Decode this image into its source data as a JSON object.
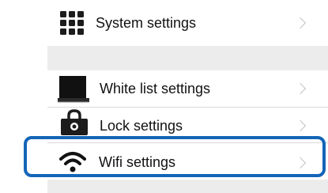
{
  "settings": {
    "items": [
      {
        "label": "System settings",
        "icon": "grid-icon"
      },
      {
        "label": "White list settings",
        "icon": "folder-icon"
      },
      {
        "label": "Lock settings",
        "icon": "lock-icon"
      },
      {
        "label": "Wifi settings",
        "icon": "wifi-icon"
      }
    ],
    "highlighted_item": "Wifi settings",
    "highlight_color": "#1465b8"
  }
}
